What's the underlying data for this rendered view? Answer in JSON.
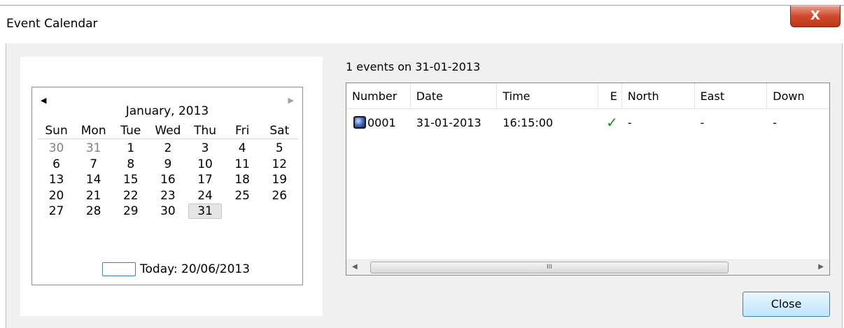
{
  "window": {
    "title": "Event Calendar",
    "close_glyph": "X"
  },
  "calendar": {
    "prev_glyph": "◀",
    "next_glyph": "▶",
    "month_title": "January, 2013",
    "weekdays": [
      "Sun",
      "Mon",
      "Tue",
      "Wed",
      "Thu",
      "Fri",
      "Sat"
    ],
    "weeks": [
      [
        "30",
        "31",
        "1",
        "2",
        "3",
        "4",
        "5"
      ],
      [
        "6",
        "7",
        "8",
        "9",
        "10",
        "11",
        "12"
      ],
      [
        "13",
        "14",
        "15",
        "16",
        "17",
        "18",
        "19"
      ],
      [
        "20",
        "21",
        "22",
        "23",
        "24",
        "25",
        "26"
      ],
      [
        "27",
        "28",
        "29",
        "30",
        "31",
        "",
        ""
      ]
    ],
    "selected_day": "31",
    "today_label": "Today: 20/06/2013"
  },
  "events": {
    "summary": "1 events on 31-01-2013",
    "columns": [
      "Number",
      "Date",
      "Time",
      "E",
      "North",
      "East",
      "Down"
    ],
    "rows": [
      {
        "number": "0001",
        "date": "31-01-2013",
        "time": "16:15:00",
        "e": "✓",
        "north": "-",
        "east": "-",
        "down": "-"
      }
    ],
    "scroll_thumb_label": "III"
  },
  "buttons": {
    "close": "Close"
  }
}
